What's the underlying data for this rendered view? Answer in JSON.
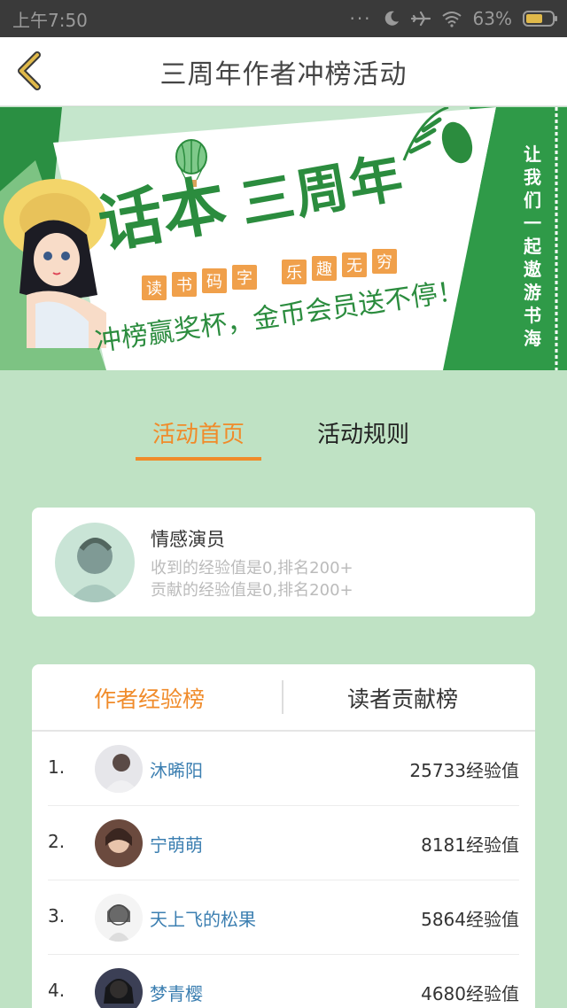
{
  "status_bar": {
    "time": "上午7:50",
    "battery": "63%",
    "battery_level": 0.63,
    "icons": [
      "more-dots-icon",
      "moon-icon",
      "airplane-icon",
      "wifi-icon",
      "battery-icon"
    ]
  },
  "header": {
    "title": "三周年作者冲榜活动",
    "back_icon": "chevron-left-icon",
    "accent_color": "#e0b94a"
  },
  "banner": {
    "headline_left": "话本",
    "headline_right": "三周年",
    "tags": [
      "读",
      "书",
      "码",
      "字",
      "乐",
      "趣",
      "无",
      "穷"
    ],
    "slogan": "冲榜赢奖杯，金币会员送不停！",
    "vertical_text": [
      "让",
      "我",
      "们",
      "一",
      "起",
      "遨",
      "游",
      "书",
      "海"
    ]
  },
  "tabs": {
    "items": [
      {
        "label": "活动首页",
        "active": true
      },
      {
        "label": "活动规则",
        "active": false
      }
    ],
    "active_color": "#f08b2a"
  },
  "profile": {
    "name": "情感演员",
    "received_exp": "收到的经验值是0,排名200+",
    "contributed_exp": "贡献的经验值是0,排名200+"
  },
  "ranking": {
    "tabs": [
      {
        "label": "作者经验榜",
        "active": true
      },
      {
        "label": "读者贡献榜",
        "active": false
      }
    ],
    "rows": [
      {
        "rank": "1.",
        "name": "沐晞阳",
        "score": "25733经验值"
      },
      {
        "rank": "2.",
        "name": "宁萌萌",
        "score": "8181经验值"
      },
      {
        "rank": "3.",
        "name": "天上飞的松果",
        "score": "5864经验值"
      },
      {
        "rank": "4.",
        "name": "梦青樱",
        "score": "4680经验值"
      }
    ]
  },
  "colors": {
    "page_background": "#bfe2c4",
    "brand_green": "#2f9a48",
    "accent_orange": "#f08b2a",
    "username_blue": "#3c7fb1"
  }
}
